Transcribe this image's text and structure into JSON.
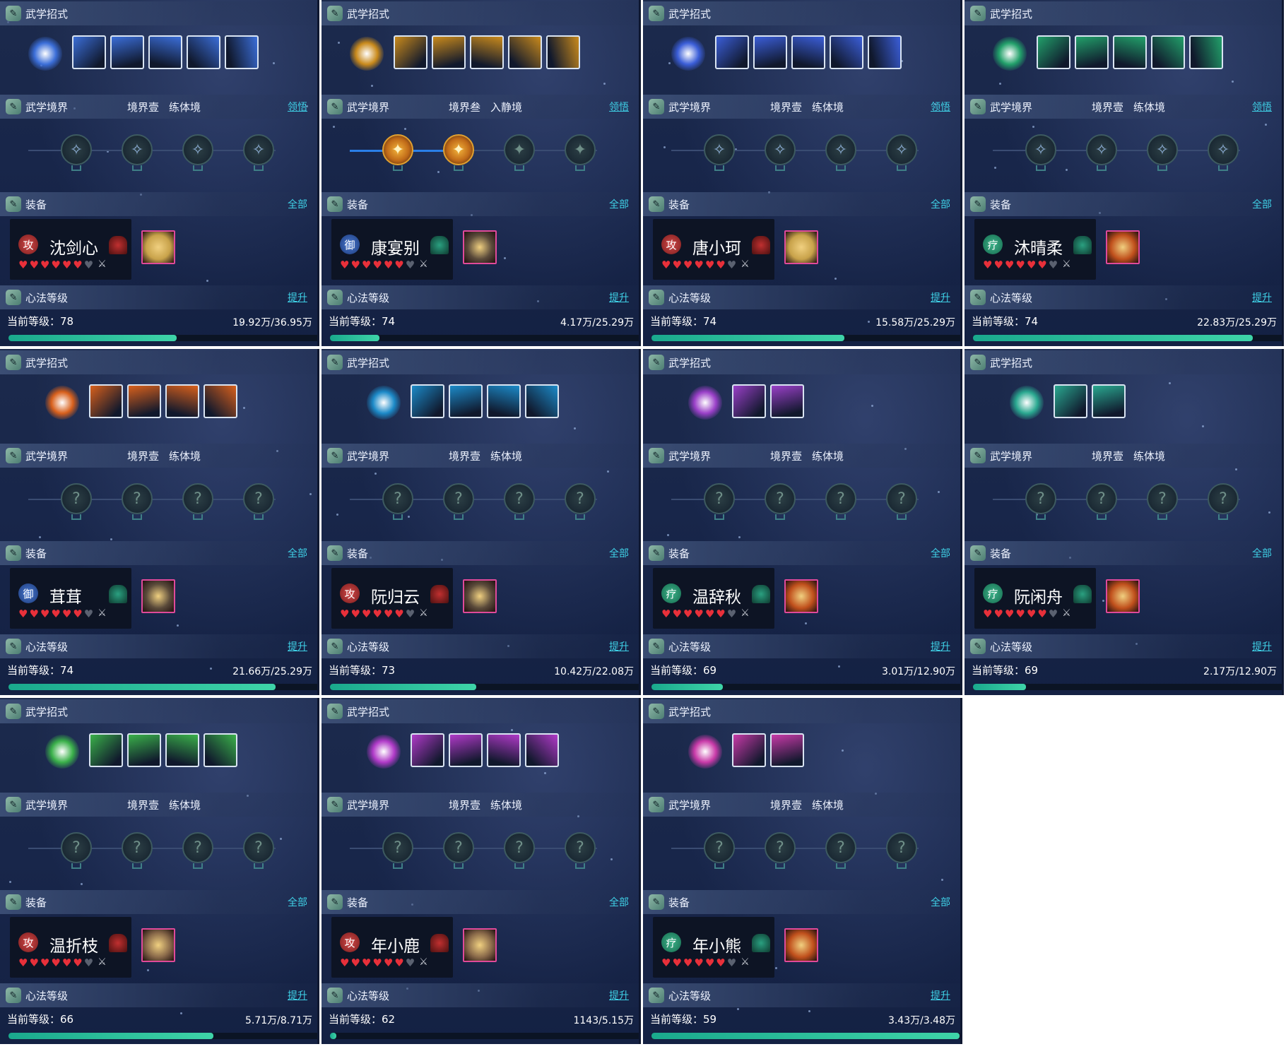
{
  "labels": {
    "skills_header": "武学招式",
    "realm_header": "武学境界",
    "equip_header": "装备",
    "equip_all": "全部",
    "mind_header": "心法等级",
    "mind_upgrade": "提升",
    "level_prefix": "当前等级：",
    "realm_link": "领悟"
  },
  "badge_glyphs": {
    "atk": "攻",
    "def": "御",
    "heal": "疗"
  },
  "heart_symbol": "♥",
  "sword_symbol": "⚔",
  "unknown_node_symbol": "?",
  "characters": [
    {
      "name": "沈剑心",
      "badge": "atk",
      "realm_level": "境界壹",
      "realm_stage": "练体境",
      "realm_link": true,
      "level": "78",
      "exp": "19.92万/36.95万",
      "progress": 0.54,
      "skill_theme": "#3b6ed8",
      "skill_count": 5,
      "realm_state": "icons",
      "realm_lit": 0,
      "hearts_full": 6,
      "gear_color": "#c8a24a"
    },
    {
      "name": "康宴别",
      "badge": "def",
      "realm_level": "境界叁",
      "realm_stage": "入静境",
      "realm_link": true,
      "level": "74",
      "exp": "4.17万/25.29万",
      "progress": 0.16,
      "skill_theme": "#c98a1c",
      "skill_count": 5,
      "realm_state": "gold",
      "realm_lit": 2,
      "hearts_full": 6,
      "gear_color": "#5a4a3a"
    },
    {
      "name": "唐小珂",
      "badge": "atk",
      "realm_level": "境界壹",
      "realm_stage": "练体境",
      "realm_link": true,
      "level": "74",
      "exp": "15.58万/25.29万",
      "progress": 0.62,
      "skill_theme": "#3b5ed8",
      "skill_count": 5,
      "realm_state": "icons",
      "realm_lit": 0,
      "hearts_full": 6,
      "gear_color": "#c8a24a"
    },
    {
      "name": "沐晴柔",
      "badge": "heal",
      "realm_level": "境界壹",
      "realm_stage": "练体境",
      "realm_link": true,
      "level": "74",
      "exp": "22.83万/25.29万",
      "progress": 0.9,
      "skill_theme": "#22a06a",
      "skill_count": 5,
      "realm_state": "icons",
      "realm_lit": 0,
      "hearts_full": 6,
      "gear_color": "#c0501c"
    },
    {
      "name": "茸茸",
      "badge": "def",
      "realm_level": "境界壹",
      "realm_stage": "练体境",
      "realm_link": false,
      "level": "74",
      "exp": "21.66万/25.29万",
      "progress": 0.86,
      "skill_theme": "#d8601c",
      "skill_count": 4,
      "realm_state": "unknown",
      "realm_lit": 0,
      "hearts_full": 6,
      "gear_color": "#5a4a3a"
    },
    {
      "name": "阮归云",
      "badge": "atk",
      "realm_level": "境界壹",
      "realm_stage": "练体境",
      "realm_link": false,
      "level": "73",
      "exp": "10.42万/22.08万",
      "progress": 0.47,
      "skill_theme": "#1c8ac8",
      "skill_count": 4,
      "realm_state": "unknown",
      "realm_lit": 0,
      "hearts_full": 6,
      "gear_color": "#5a4a3a"
    },
    {
      "name": "温辞秋",
      "badge": "heal",
      "realm_level": "境界壹",
      "realm_stage": "练体境",
      "realm_link": false,
      "level": "69",
      "exp": "3.01万/12.90万",
      "progress": 0.23,
      "skill_theme": "#9a40c8",
      "skill_count": 2,
      "realm_state": "unknown",
      "realm_lit": 0,
      "hearts_full": 6,
      "gear_color": "#c0501c"
    },
    {
      "name": "阮闲舟",
      "badge": "heal",
      "realm_level": "境界壹",
      "realm_stage": "练体境",
      "realm_link": false,
      "level": "69",
      "exp": "2.17万/12.90万",
      "progress": 0.17,
      "skill_theme": "#2aa890",
      "skill_count": 2,
      "realm_state": "unknown",
      "realm_lit": 0,
      "hearts_full": 6,
      "gear_color": "#c0501c"
    },
    {
      "name": "温折枝",
      "badge": "atk",
      "realm_level": "境界壹",
      "realm_stage": "练体境",
      "realm_link": false,
      "level": "66",
      "exp": "5.71万/8.71万",
      "progress": 0.66,
      "skill_theme": "#3ab04a",
      "skill_count": 4,
      "realm_state": "unknown",
      "realm_lit": 0,
      "hearts_full": 6,
      "gear_color": "#8a6a4a"
    },
    {
      "name": "年小鹿",
      "badge": "atk",
      "realm_level": "境界壹",
      "realm_stage": "练体境",
      "realm_link": false,
      "level": "62",
      "exp": "1143/5.15万",
      "progress": 0.02,
      "skill_theme": "#b03ac8",
      "skill_count": 4,
      "realm_state": "unknown",
      "realm_lit": 0,
      "hearts_full": 6,
      "gear_color": "#8a6a4a"
    },
    {
      "name": "年小熊",
      "badge": "heal",
      "realm_level": "境界壹",
      "realm_stage": "练体境",
      "realm_link": false,
      "level": "59",
      "exp": "3.43万/3.48万",
      "progress": 0.99,
      "skill_theme": "#c83aa8",
      "skill_count": 2,
      "realm_state": "unknown",
      "realm_lit": 0,
      "hearts_full": 6,
      "gear_color": "#c0501c"
    }
  ]
}
